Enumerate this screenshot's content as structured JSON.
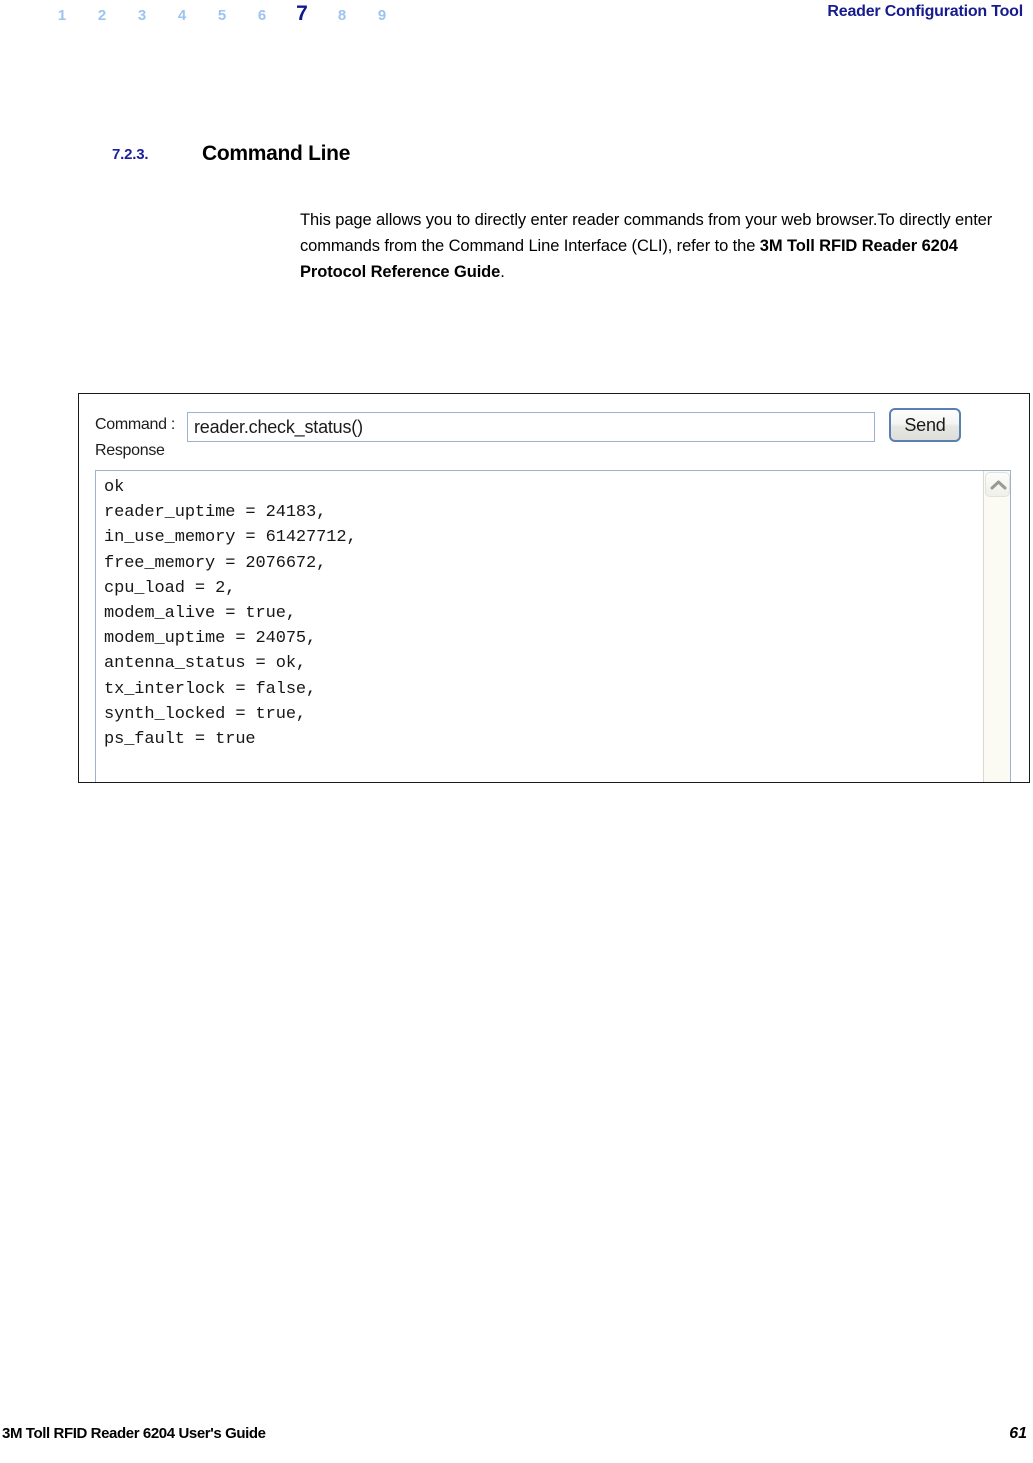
{
  "header": {
    "chapters": [
      "1",
      "2",
      "3",
      "4",
      "5",
      "6",
      "7",
      "8",
      "9"
    ],
    "current_chapter": "7",
    "title": "Reader Configuration Tool",
    "inactive_color": "#9dc3f0",
    "active_color": "#101a8c",
    "title_color": "#161c8e"
  },
  "section": {
    "number": "7.2.3.",
    "title": "Command Line",
    "number_color": "#1a1f9e"
  },
  "body": {
    "paragraph_part1": "This page allows you to directly enter reader commands from your web browser.To directly enter commands from the Command Line Interface (CLI), refer to the ",
    "paragraph_bold": "3M Toll RFID Reader 6204 Protocol Reference Guide",
    "paragraph_part2": "."
  },
  "screenshot": {
    "command_label": "Command :",
    "command_value": "reader.check_status()",
    "command_placeholder": "",
    "send_label": "Send",
    "response_label": "Response",
    "response_lines": [
      "ok",
      "reader_uptime = 24183,",
      "in_use_memory = 61427712,",
      "free_memory = 2076672,",
      "cpu_load = 2,",
      "modem_alive = true,",
      "modem_uptime = 24075,",
      "antenna_status = ok,",
      "tx_interlock = false,",
      "synth_locked = true,",
      "ps_fault = true"
    ],
    "response_text": "ok\nreader_uptime = 24183,\nin_use_memory = 61427712,\nfree_memory = 2076672,\ncpu_load = 2,\nmodem_alive = true,\nmodem_uptime = 24075,\nantenna_status = ok,\ntx_interlock = false,\nsynth_locked = true,\nps_fault = true",
    "scroll_up_icon": "chevron-up-icon"
  },
  "footer": {
    "left_text": "3M Toll RFID Reader 6204 User's Guide",
    "page_number": "61"
  }
}
